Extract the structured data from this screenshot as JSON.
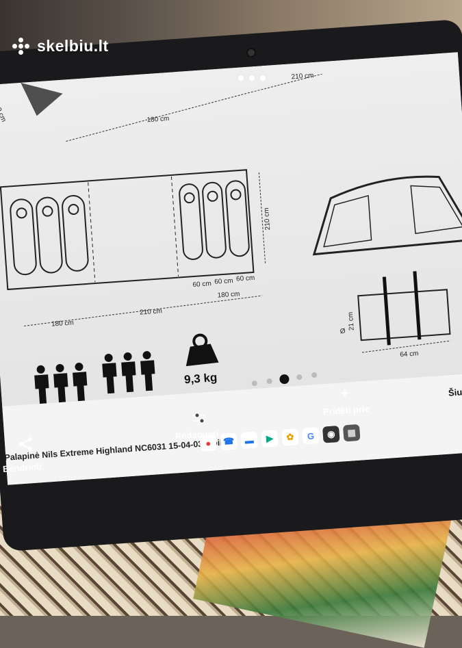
{
  "watermark": "skelbiu.lt",
  "diagram": {
    "dim_top_left": "180 cm",
    "dim_top_right": "210 cm",
    "dim_top_side": "210 cm",
    "dim_floor_180": "180 cm",
    "dim_floor_210": "210 cm",
    "dim_floor_right_180": "180 cm",
    "dim_60_a": "60 cm",
    "dim_60_b": "60 cm",
    "dim_60_c": "60 cm",
    "dim_depth": "210 cm",
    "bag_diameter_symbol": "Ø",
    "bag_diameter": "21 cm",
    "bag_length": "64 cm",
    "weight": "9,3 kg",
    "persons": 6
  },
  "carousel": {
    "pages": 5,
    "active": 3
  },
  "toolbar": {
    "share_label": "Bendrinti",
    "edit_label": "Redaguoti",
    "add_label": "Pridėti prie",
    "add_icon": "+",
    "cut_label": "Šiu"
  },
  "caption": "Palapinė Nils Extreme Highland NC6031 15-04-033. pilka",
  "dock": {
    "apps": [
      "maps-icon",
      "phone-icon",
      "messages-icon",
      "play-store-icon",
      "photos-icon",
      "google-icon",
      "camera-icon",
      "apps-grid-icon"
    ],
    "google_letter": "G"
  }
}
